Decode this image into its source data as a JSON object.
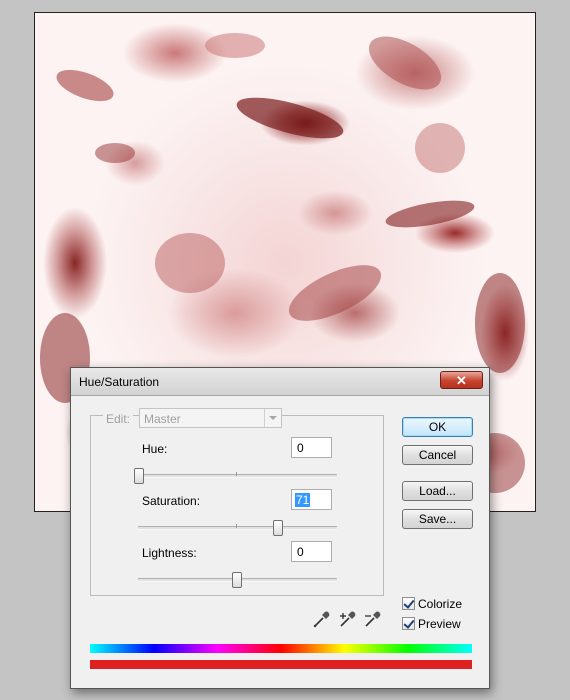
{
  "dialog": {
    "title": "Hue/Saturation",
    "edit_label": "Edit:",
    "edit_value": "Master",
    "hue": {
      "label": "Hue:",
      "value": "0",
      "slider_fraction": 0.0
    },
    "saturation": {
      "label": "Saturation:",
      "value": "71",
      "slider_fraction": 0.68
    },
    "lightness": {
      "label": "Lightness:",
      "value": "0",
      "slider_fraction": 0.5
    },
    "buttons": {
      "ok": "OK",
      "cancel": "Cancel",
      "load": "Load...",
      "save": "Save..."
    },
    "colorize": {
      "label": "Colorize",
      "checked": true
    },
    "preview": {
      "label": "Preview",
      "checked": true
    },
    "icons": [
      "eyedropper-icon",
      "eyedropper-plus-icon",
      "eyedropper-minus-icon"
    ],
    "result_color": "#dd2020"
  }
}
